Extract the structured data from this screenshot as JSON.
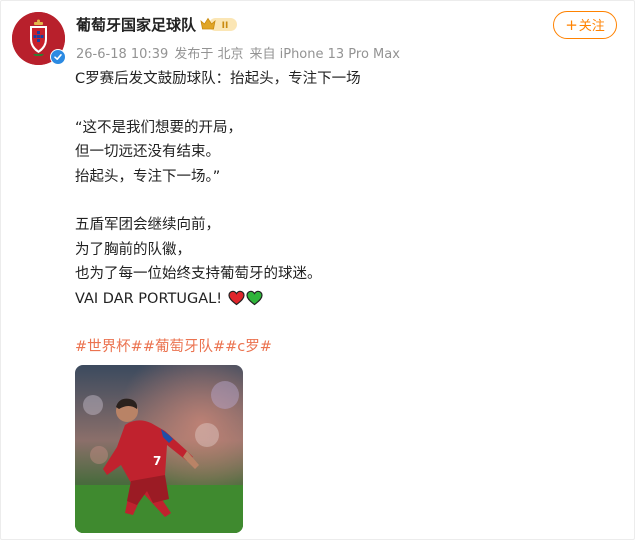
{
  "post": {
    "author": "葡萄牙国家足球队",
    "badge_text": "II",
    "follow_label": "关注",
    "meta": {
      "date": "26-6-18 10:39",
      "location": "发布于 北京",
      "device": "来自 iPhone 13 Pro Max"
    },
    "content": {
      "title_line": "C罗赛后发文鼓励球队：抬起头，专注下一场",
      "quote_lines": [
        "“这不是我们想要的开局，",
        "但一切远还没有结束。",
        "抬起头，专注下一场。”"
      ],
      "body_lines": [
        "五盾军团会继续向前，",
        "为了胸前的队徽，",
        "也为了每一位始终支持葡萄牙的球迷。"
      ],
      "slogan": "VAI DAR PORTUGAL!",
      "hashtags": [
        "#世界杯#",
        "#葡萄牙队#",
        "#c罗#"
      ]
    },
    "icons": {
      "hearts": [
        "red-heart-icon",
        "green-heart-icon"
      ],
      "verified": "verified-badge-icon",
      "crest": "fpf-crest-icon"
    },
    "colors": {
      "accent": "#ff8200",
      "hashtag": "#eb7350",
      "meta_text": "#939393",
      "verified": "#2b8ae2",
      "jersey_red": "#b8202c"
    }
  }
}
